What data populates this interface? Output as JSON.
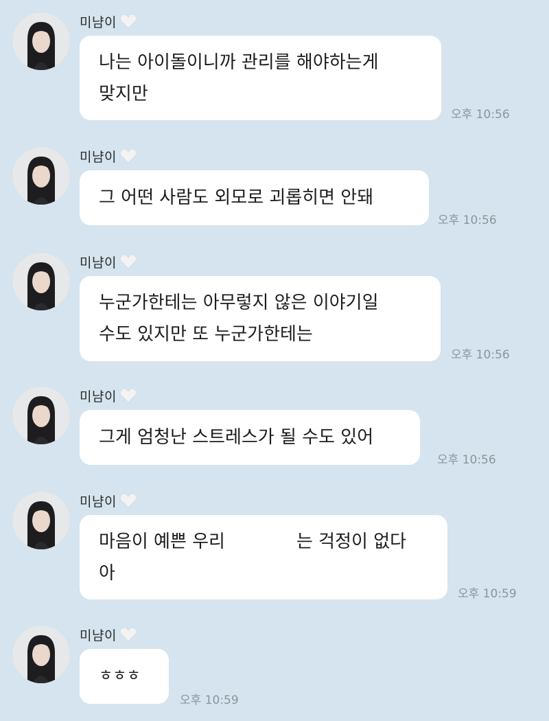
{
  "messages": [
    {
      "sender": "미냠이",
      "lines": [
        "나는 아이돌이니까 관리를 해야하는게",
        "맞지만"
      ],
      "time": "오후 10:56"
    },
    {
      "sender": "미냠이",
      "lines": [
        "그 어떤 사람도 외모로 괴롭히면 안돼"
      ],
      "time": "오후 10:56"
    },
    {
      "sender": "미냠이",
      "lines": [
        "누군가한테는 아무렇지 않은 이야기일",
        "수도 있지만 또 누군가한테는"
      ],
      "time": "오후 10:56"
    },
    {
      "sender": "미냠이",
      "lines": [
        "그게 엄청난 스트레스가 될 수도 있어"
      ],
      "time": "오후 10:56"
    },
    {
      "sender": "미냠이",
      "line_before_gap": "마음이 예쁜 우리",
      "line_after_gap": "는 걱정이 없다",
      "line_2": "아",
      "time": "오후 10:59"
    },
    {
      "sender": "미냠이",
      "lines": [
        "ㅎㅎㅎ"
      ],
      "time": "오후 10:59"
    }
  ],
  "colors": {
    "background": "#d5e4ee",
    "bubble": "#ffffff",
    "timestamp": "#8b959c",
    "heart": "#f2f2f2"
  },
  "icons": {
    "heart": "white-heart-icon",
    "avatar": "profile-avatar"
  }
}
